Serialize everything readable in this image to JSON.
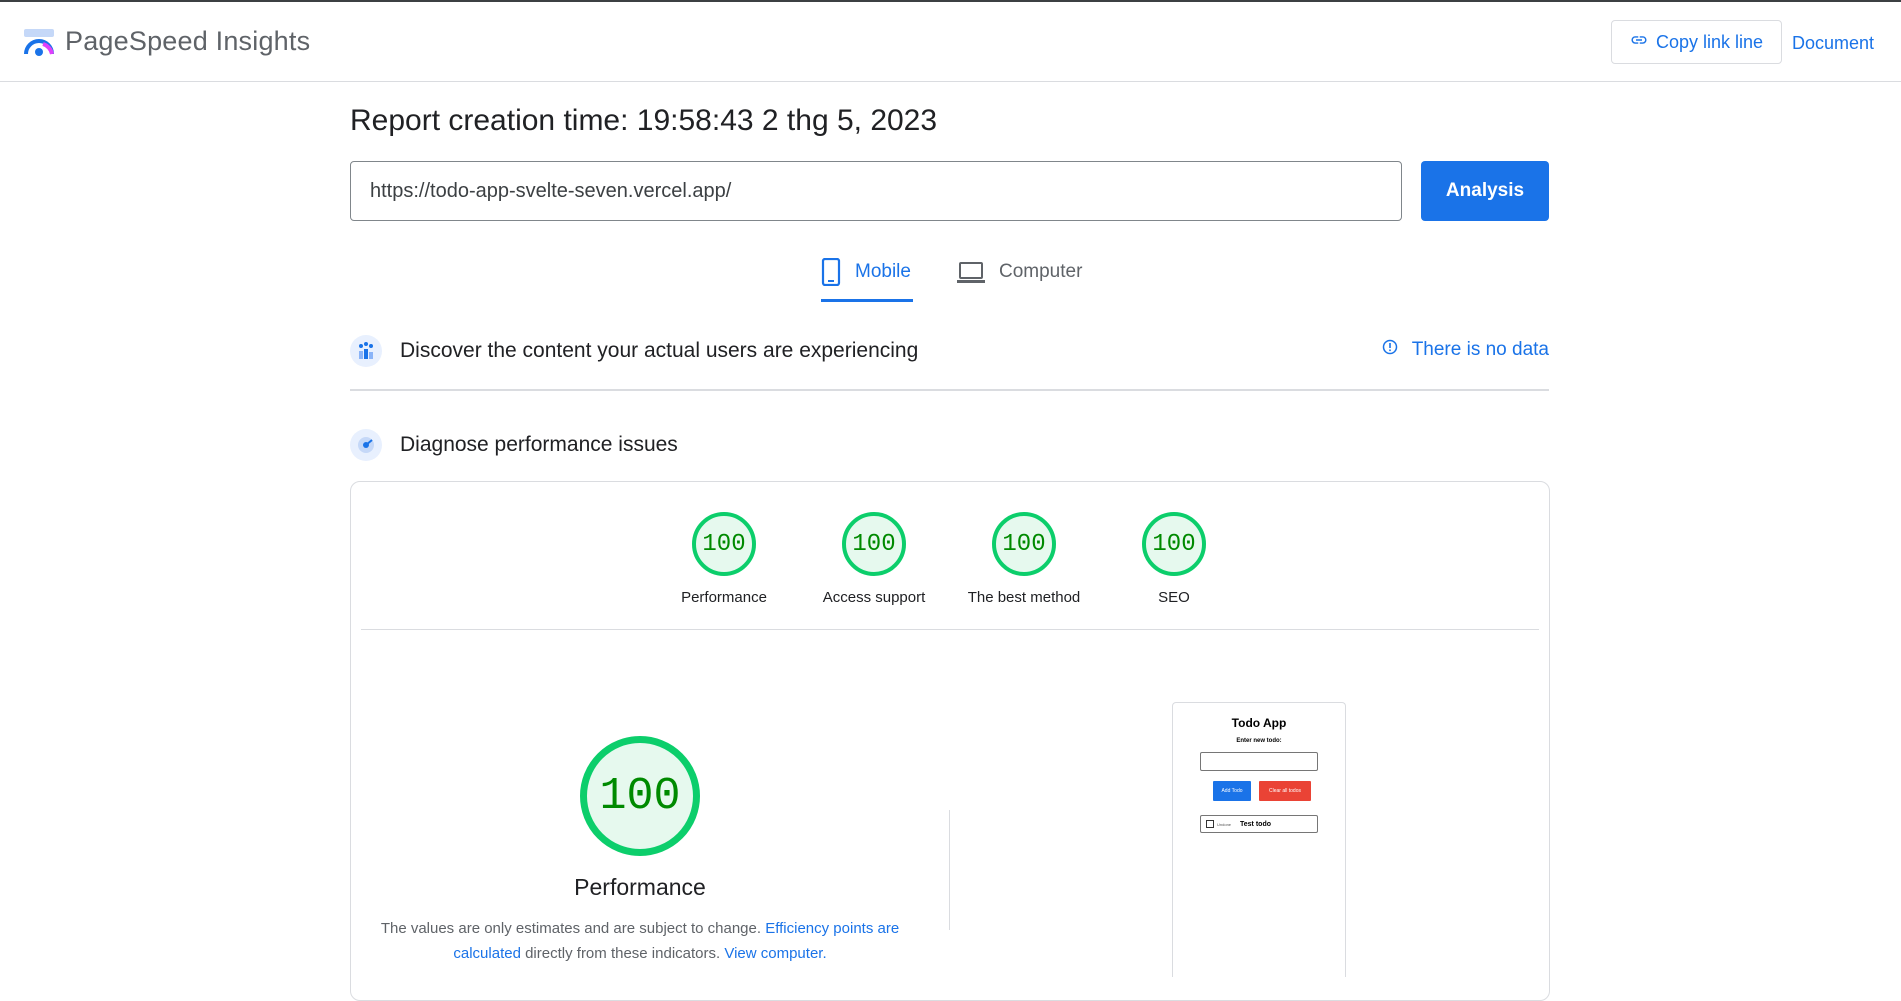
{
  "header": {
    "app_title": "PageSpeed Insights",
    "copy_link_label": "Copy link line",
    "document_label": "Document"
  },
  "report": {
    "creation_time": "Report creation time: 19:58:43 2 thg 5, 2023",
    "url_value": "https://todo-app-svelte-seven.vercel.app/",
    "analyze_label": "Analysis"
  },
  "tabs": [
    {
      "label": "Mobile",
      "icon": "phone-icon",
      "selected": true
    },
    {
      "label": "Computer",
      "icon": "laptop-icon",
      "selected": false
    }
  ],
  "field_data": {
    "title": "Discover the content your actual users are experiencing",
    "no_data_label": "There is no data"
  },
  "diagnose": {
    "title": "Diagnose performance issues"
  },
  "scores": [
    {
      "label": "Performance",
      "value": "100"
    },
    {
      "label": "Access support",
      "value": "100"
    },
    {
      "label": "The best method",
      "value": "100"
    },
    {
      "label": "SEO",
      "value": "100"
    }
  ],
  "main_score": {
    "value": "100",
    "title": "Performance",
    "disclaimer_prefix": "The values are only estimates and are subject to change.",
    "efficiency_link": "Efficiency points are calculated",
    "disclaimer_middle": "directly from these indicators.",
    "view_link": "View computer."
  },
  "preview": {
    "title": "Todo App",
    "input_label": "Enter new todo:",
    "add_button": "Add Todo",
    "clear_button": "Clear all todos",
    "item_status": "Undone",
    "item_text": "Test todo"
  },
  "colors": {
    "accent": "#1a73e8",
    "pass": "#0cce6b",
    "pass_text": "#008a00",
    "danger": "#ea4335"
  }
}
